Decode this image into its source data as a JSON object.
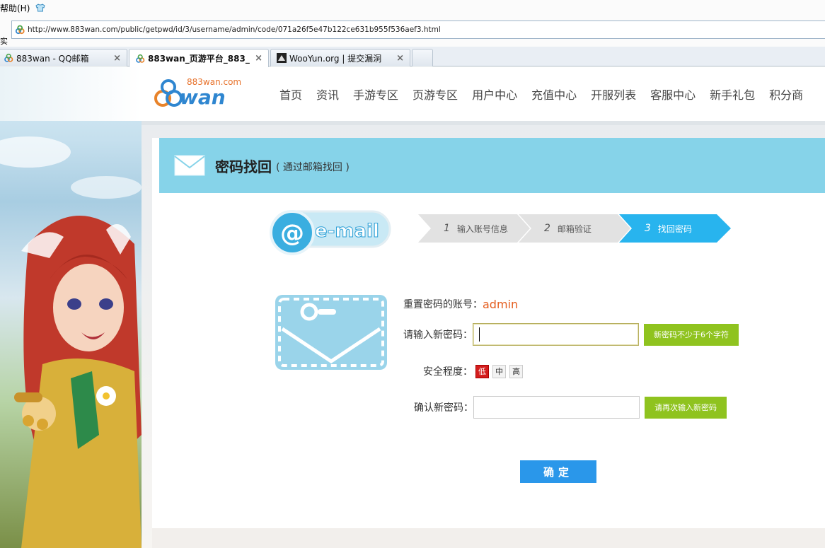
{
  "browser": {
    "menu_help": "帮助(H)",
    "url": "http://www.883wan.com/public/getpwd/id/3/username/admin/code/071a26f5e47b122ce631b955f536aef3.html",
    "stray_label": "实",
    "tabs": [
      {
        "title": "883wan - QQ邮箱",
        "close": "×"
      },
      {
        "title": "883wan_页游平台_883_...",
        "close": "×"
      },
      {
        "title": "WooYun.org | 提交漏洞",
        "close": "×"
      }
    ]
  },
  "site": {
    "logo_domain": "883wan.com",
    "logo_text": "wan",
    "nav": [
      "首页",
      "资讯",
      "手游专区",
      "页游专区",
      "用户中心",
      "充值中心",
      "开服列表",
      "客服中心",
      "新手礼包",
      "积分商"
    ]
  },
  "panel": {
    "title": "密码找回",
    "subtitle": "( 通过邮箱找回 )",
    "email_logo": "e-mail",
    "steps": [
      {
        "num": "1",
        "label": "输入账号信息"
      },
      {
        "num": "2",
        "label": "邮箱验证"
      },
      {
        "num": "3",
        "label": "找回密码"
      }
    ]
  },
  "form": {
    "account_label": "重置密码的账号：",
    "account_value": "admin",
    "new_pwd_label": "请输入新密码：",
    "new_pwd_hint": "新密码不少于6个字符",
    "strength_label": "安全程度：",
    "strength_levels": [
      "低",
      "中",
      "高"
    ],
    "confirm_label": "确认新密码：",
    "confirm_hint": "请再次输入新密码",
    "submit_label": "确定"
  },
  "colors": {
    "header_band": "#86d3e9",
    "step_active": "#28b4ee",
    "hint_green": "#8fc31f",
    "button_blue": "#2a97ea",
    "account_orange": "#e45d1e",
    "strength_low": "#d31d1d"
  }
}
